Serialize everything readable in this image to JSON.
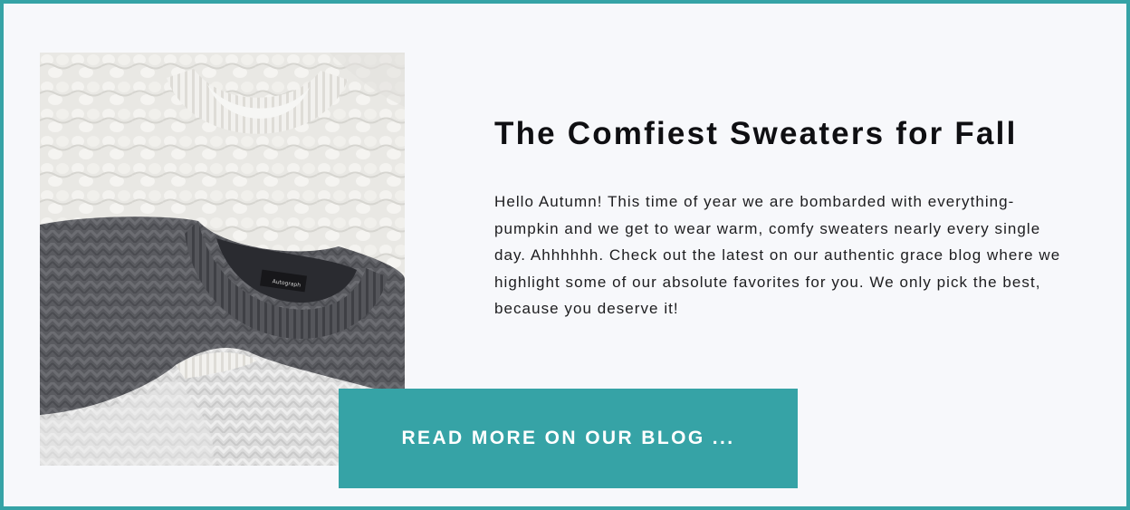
{
  "post": {
    "title": "The Comfiest Sweaters for Fall",
    "body": "Hello Autumn!  This time of year we are bombarded with everything-pumpkin and we get to wear warm, comfy sweaters nearly every single day.  Ahhhhhh.  Check out the latest on our authentic grace blog where we highlight some of our absolute favorites for you.  We only pick the best, because you deserve it!",
    "cta_label": "READ MORE ON OUR BLOG ...",
    "image_alt": "Stacked knit sweaters in white, charcoal and grey"
  },
  "colors": {
    "accent": "#36a3a6",
    "background": "#f7f8fb",
    "title_text": "#0f0f12",
    "cta_text": "#ffffff"
  }
}
